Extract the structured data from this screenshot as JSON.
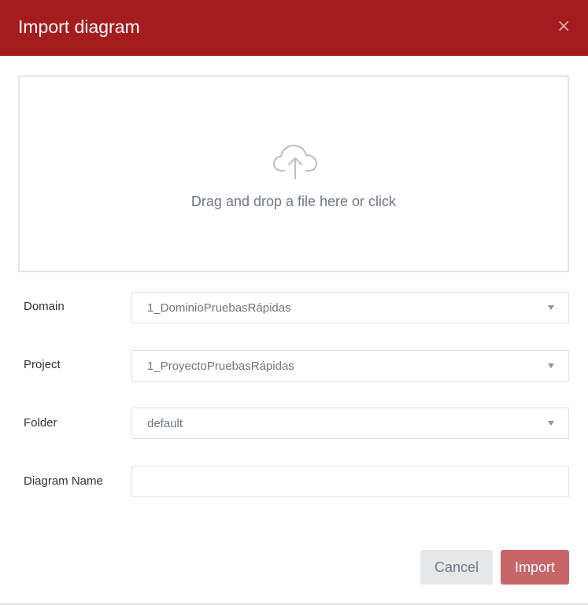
{
  "dialog": {
    "title": "Import diagram",
    "close_label": "×"
  },
  "dropzone": {
    "icon": "cloud-upload-icon",
    "text": "Drag and drop a file here or click"
  },
  "fields": {
    "domain": {
      "label": "Domain",
      "value": "1_DominioPruebasRápidas"
    },
    "project": {
      "label": "Project",
      "value": "1_ProyectoPruebasRápidas"
    },
    "folder": {
      "label": "Folder",
      "value": "default"
    },
    "diagram_name": {
      "label": "Diagram Name",
      "value": ""
    }
  },
  "buttons": {
    "cancel": "Cancel",
    "import": "Import"
  },
  "colors": {
    "header": "#a51c1f",
    "import_button": "#c76668",
    "cancel_button": "#e4e8eb"
  }
}
